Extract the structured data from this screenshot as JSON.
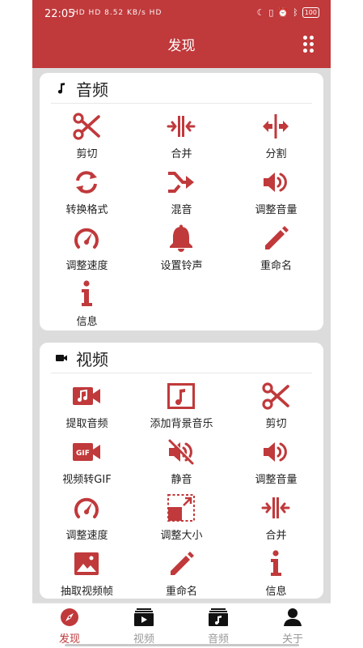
{
  "status_bar": {
    "time": "22:05",
    "network": "HD HD 8.52 KB/s HD",
    "battery": "100"
  },
  "header": {
    "title": "发现"
  },
  "audio": {
    "title": "音频",
    "items": [
      {
        "label": "剪切",
        "icon": "scissors-icon"
      },
      {
        "label": "合并",
        "icon": "merge-icon"
      },
      {
        "label": "分割",
        "icon": "split-icon"
      },
      {
        "label": "转换格式",
        "icon": "convert-icon"
      },
      {
        "label": "混音",
        "icon": "mix-icon"
      },
      {
        "label": "调整音量",
        "icon": "volume-icon"
      },
      {
        "label": "调整速度",
        "icon": "speed-icon"
      },
      {
        "label": "设置铃声",
        "icon": "bell-icon"
      },
      {
        "label": "重命名",
        "icon": "pencil-icon"
      },
      {
        "label": "信息",
        "icon": "info-icon"
      }
    ]
  },
  "video": {
    "title": "视频",
    "items": [
      {
        "label": "提取音频",
        "icon": "extract-audio-icon"
      },
      {
        "label": "添加背景音乐",
        "icon": "music-frame-icon"
      },
      {
        "label": "剪切",
        "icon": "scissors-icon"
      },
      {
        "label": "视频转GIF",
        "icon": "gif-icon"
      },
      {
        "label": "静音",
        "icon": "mute-icon"
      },
      {
        "label": "调整音量",
        "icon": "volume-icon"
      },
      {
        "label": "调整速度",
        "icon": "speed-icon"
      },
      {
        "label": "调整大小",
        "icon": "resize-icon"
      },
      {
        "label": "合并",
        "icon": "merge-icon"
      },
      {
        "label": "抽取视频帧",
        "icon": "image-icon"
      },
      {
        "label": "重命名",
        "icon": "pencil-icon"
      },
      {
        "label": "信息",
        "icon": "info-icon"
      }
    ]
  },
  "nav": {
    "tabs": [
      {
        "label": "发现",
        "icon": "compass-icon",
        "active": true
      },
      {
        "label": "视频",
        "icon": "video-folder-icon",
        "active": false
      },
      {
        "label": "音频",
        "icon": "audio-folder-icon",
        "active": false
      },
      {
        "label": "关于",
        "icon": "person-icon",
        "active": false
      }
    ]
  },
  "colors": {
    "accent": "#c0393b",
    "background": "#dcdcdc",
    "card": "#ffffff",
    "inactive_tab": "#9a9a9a"
  }
}
